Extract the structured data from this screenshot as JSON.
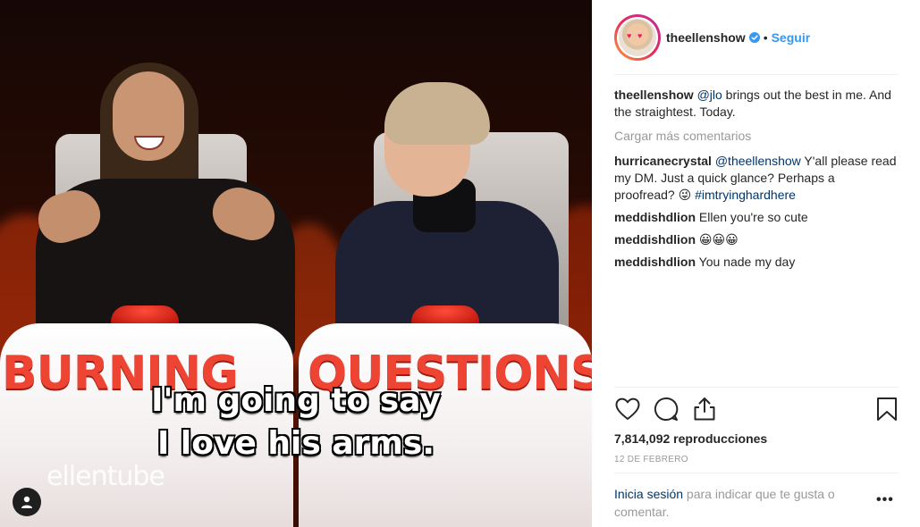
{
  "video": {
    "caption_line1": "I'm going to say",
    "caption_line2": "I love his arms.",
    "podium_left": "BURNING",
    "podium_right": "QUESTIONS",
    "watermark": "ellentube"
  },
  "header": {
    "username": "theellenshow",
    "separator": "•",
    "follow_label": "Seguir"
  },
  "caption": {
    "user": "theellenshow",
    "mention": "@jlo",
    "text": " brings out the best in me. And the straightest. Today."
  },
  "load_more": "Cargar más comentarios",
  "comments": [
    {
      "user": "hurricanecrystal",
      "mention": "@theellenshow",
      "text": " Y'all please read my DM. Just a quick glance? Perhaps a proofread? 😜 ",
      "hashtag": "#imtryinghardhere"
    },
    {
      "user": "meddishdlion",
      "text": "Ellen you're so cute"
    },
    {
      "user": "meddishdlion",
      "text": "😀😀😀"
    },
    {
      "user": "meddishdlion",
      "text": "You nade my day"
    }
  ],
  "stats": {
    "views": "7,814,092 reproducciones",
    "date": "12 de febrero"
  },
  "footer": {
    "login_link": "Inicia sesión",
    "login_text": " para indicar que te gusta o comentar.",
    "more_options": "•••"
  },
  "icons": {
    "like": "heart-icon",
    "comment": "comment-bubble-icon",
    "share": "share-icon",
    "save": "bookmark-icon",
    "verified": "verified-badge-icon",
    "user_tag": "user-tag-icon"
  },
  "colors": {
    "link_blue": "#3897f0",
    "dark_link": "#003569",
    "muted": "#999999",
    "text": "#262626",
    "podium_red": "#ee4433"
  }
}
